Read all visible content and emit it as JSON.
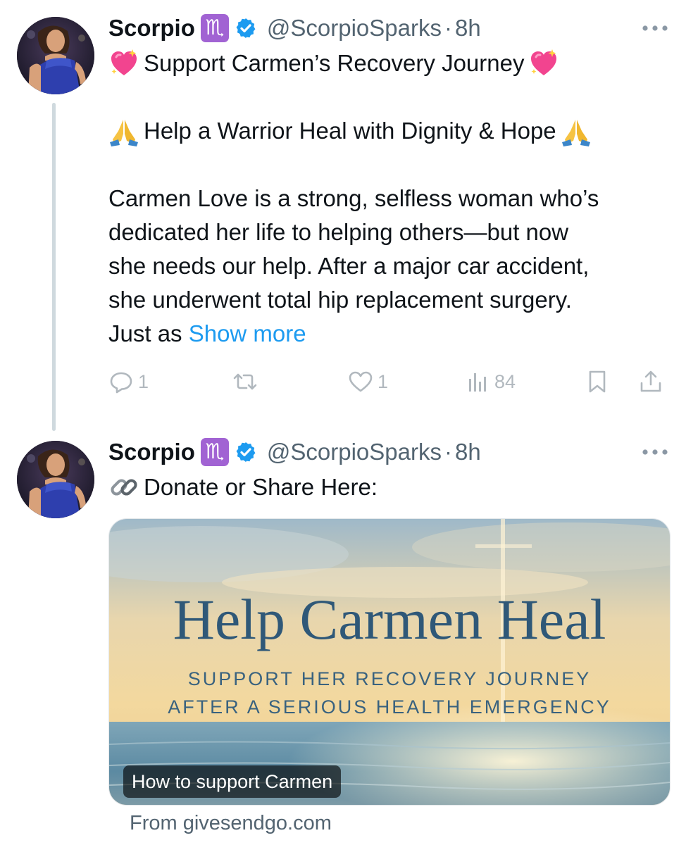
{
  "tweets": [
    {
      "author": {
        "name": "Scorpio",
        "zodiac_badge": "♏",
        "verified": true,
        "handle": "@ScorpioSparks",
        "separator": "·",
        "time": "8h"
      },
      "text": {
        "title": "Support Carmen’s Recovery Journey",
        "subtitle": "Help a Warrior Heal with Dignity & Hope",
        "paragraph_lines": [
          "Carmen Love is a strong, selfless woman who’s",
          "dedicated her life to helping others—but now",
          "she needs our help. After a major car accident,",
          "she underwent total hip replacement surgery."
        ],
        "last_line_prefix": "Just as ",
        "show_more": "Show more"
      },
      "actions": {
        "replies": "1",
        "retweets": "",
        "likes": "1",
        "views": "84"
      },
      "icons": {
        "title_emoji": "sparkling-heart",
        "subtitle_emoji": "folded-hands"
      }
    },
    {
      "author": {
        "name": "Scorpio",
        "zodiac_badge": "♏",
        "verified": true,
        "handle": "@ScorpioSparks",
        "separator": "·",
        "time": "8h"
      },
      "text": {
        "line": "Donate or Share Here:"
      },
      "icons": {
        "line_emoji": "link"
      },
      "card": {
        "title": "Help Carmen Heal",
        "subtitle_line1": "SUPPORT HER RECOVERY JOURNEY",
        "subtitle_line2": "AFTER A SERIOUS HEALTH EMERGENCY",
        "badge": "How to support Carmen",
        "source": "From givesendgo.com"
      }
    }
  ],
  "colors": {
    "link": "#1d9bf0",
    "secondary_text": "#536471",
    "zodiac_badge_bg": "#a163d3",
    "verified_badge": "#1d9bf0"
  }
}
